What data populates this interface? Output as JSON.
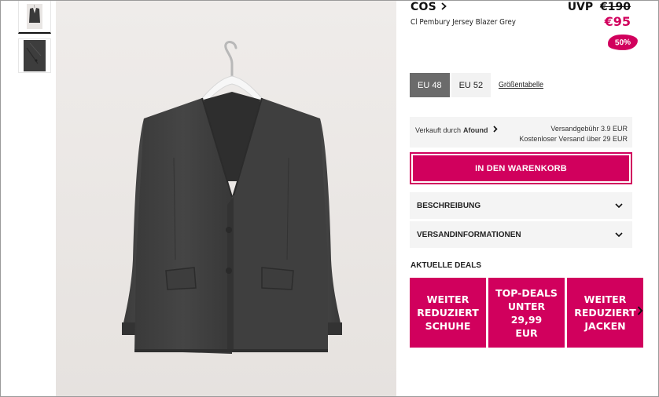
{
  "product": {
    "brand": "COS",
    "name": "Cl Pembury Jersey Blazer Grey",
    "uvp_label": "UVP",
    "old_price": "€190",
    "price": "€95",
    "discount": "50%"
  },
  "sizes": {
    "options": [
      {
        "label": "EU 48",
        "selected": true
      },
      {
        "label": "EU 52",
        "selected": false
      }
    ],
    "size_chart_link": "Größentabelle"
  },
  "seller": {
    "sold_by_label": "Verkauft durch",
    "seller_name": "Afound",
    "shipping_fee": "Versandgebühr 3.9 EUR",
    "free_shipping": "Kostenloser Versand über 29 EUR"
  },
  "cart": {
    "button_label": "IN DEN WARENKORB"
  },
  "accordion": {
    "description_label": "BESCHREIBUNG",
    "shipping_label": "VERSANDINFORMATIONEN"
  },
  "deals": {
    "title": "AKTUELLE DEALS",
    "items": [
      {
        "label": "WEITER\nREDUZIERT\nSCHUHE"
      },
      {
        "label": "TOP-DEALS\nUNTER 29,99\nEUR"
      },
      {
        "label": "WEITER\nREDUZIERT\nJACKEN"
      }
    ]
  },
  "colors": {
    "accent": "#d1005d",
    "selected_size_bg": "#6b6b6b",
    "panel_bg": "#f4f4f4",
    "image_bg": "#ece9e7"
  },
  "icons": {
    "brand_chevron": "chevron-right-icon",
    "seller_chevron": "chevron-right-icon",
    "accordion_chevron": "chevron-down-icon",
    "deals_next": "chevron-right-icon"
  }
}
